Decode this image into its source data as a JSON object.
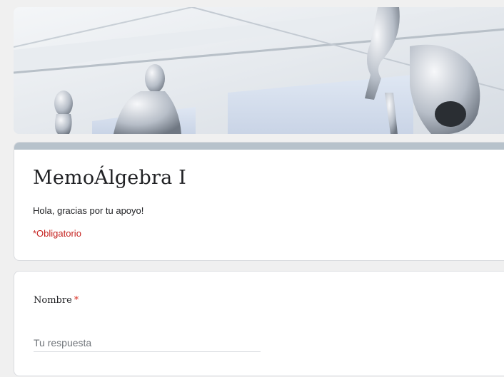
{
  "form": {
    "title": "MemoÁlgebra I",
    "description": "Hola, gracias por tu apoyo!",
    "required_note": "*Obligatorio"
  },
  "questions": [
    {
      "label": "Nombre",
      "required_marker": "*",
      "placeholder": "Tu respuesta"
    }
  ],
  "colors": {
    "header_bar": "#b7c2cb",
    "required": "#c5221f",
    "background": "#f0f0f0"
  }
}
